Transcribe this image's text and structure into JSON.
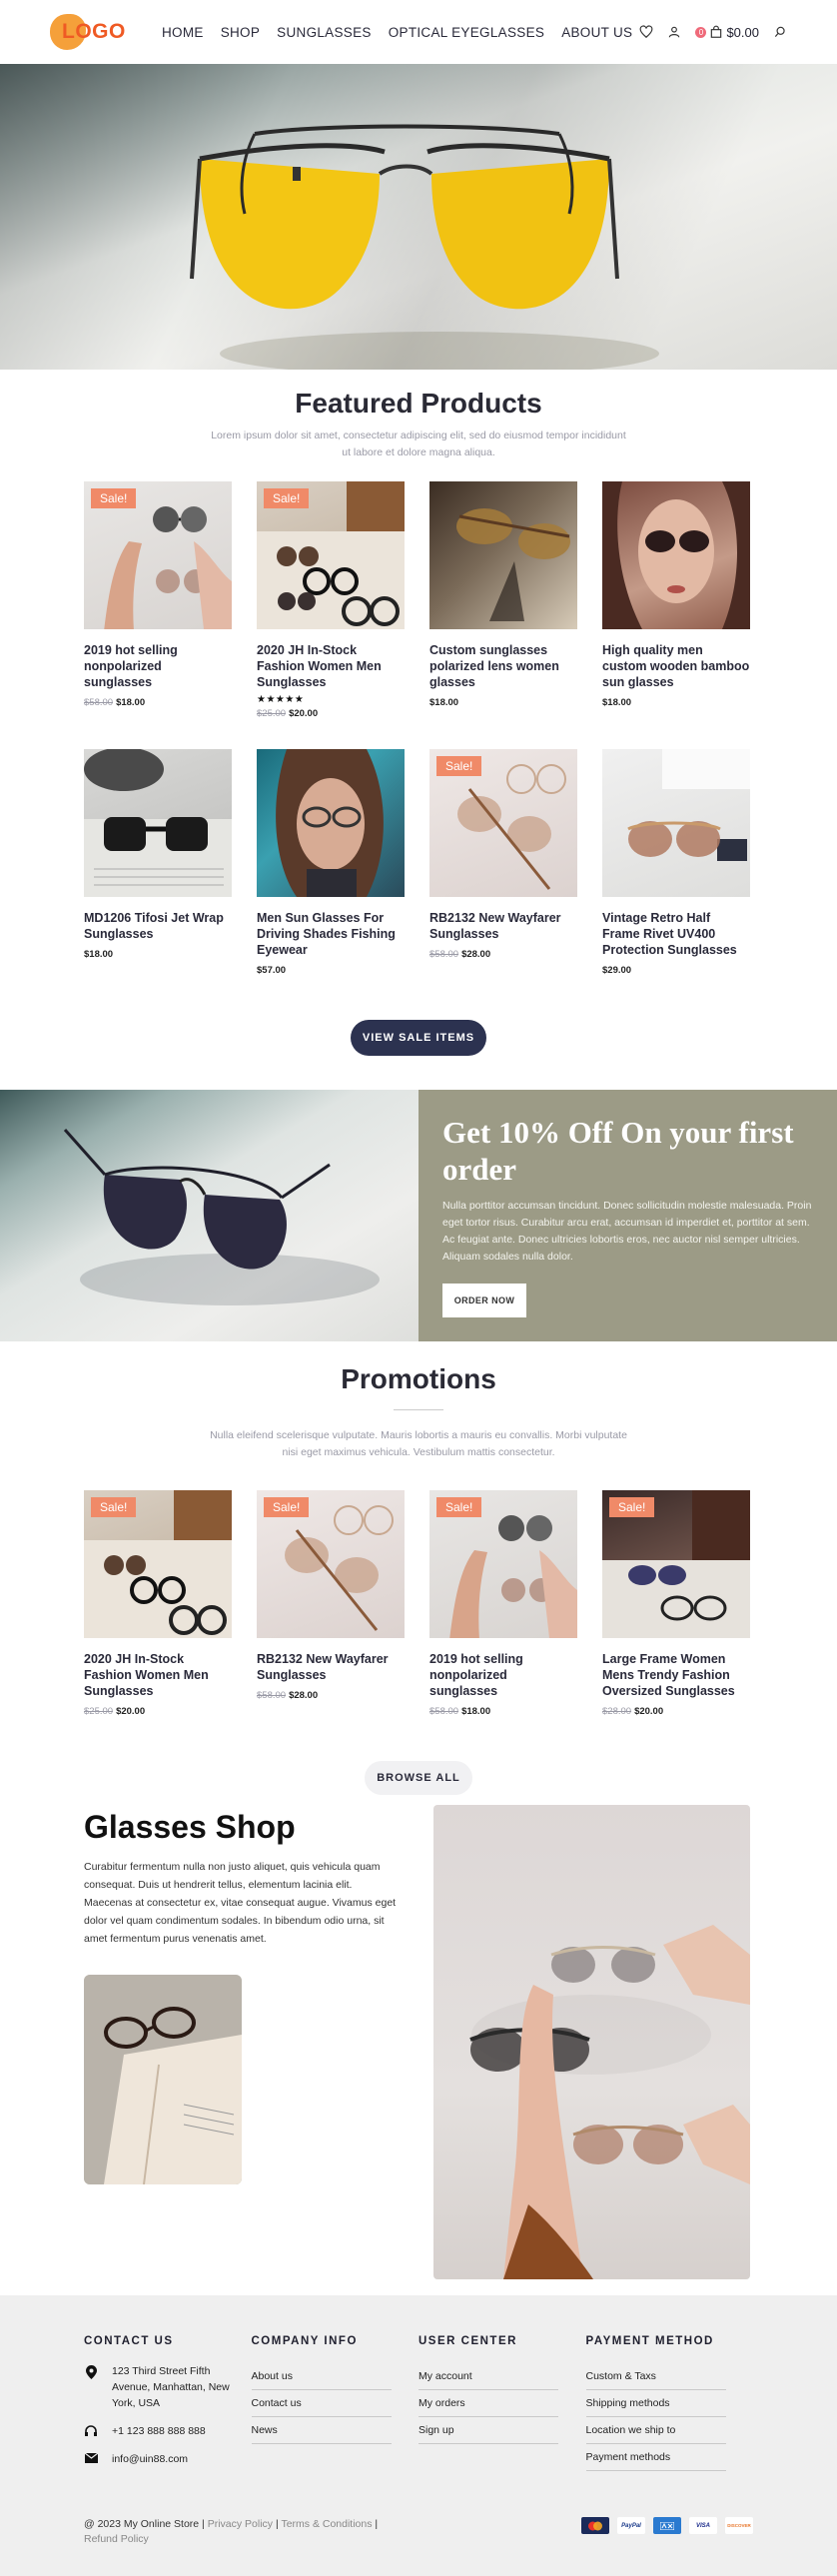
{
  "header": {
    "logo_text": "LOGO",
    "nav": [
      "HOME",
      "SHOP",
      "SUNGLASSES",
      "OPTICAL EYEGLASSES",
      "ABOUT US"
    ],
    "cart_count": "0",
    "cart_total": "$0.00"
  },
  "featured": {
    "title": "Featured Products",
    "subtitle": "Lorem ipsum dolor sit amet, consectetur adipiscing elit, sed do eiusmod tempor incididunt ut labore et dolore magna aliqua.",
    "products": [
      {
        "sale": "Sale!",
        "title": "2019 hot selling nonpolarized sunglasses",
        "old_price": "$58.00",
        "price": "$18.00"
      },
      {
        "sale": "Sale!",
        "title": "2020 JH In-Stock Fashion Women Men Sunglasses",
        "rating": 5,
        "old_price": "$25.00",
        "price": "$20.00"
      },
      {
        "sale": "",
        "title": "Custom sunglasses polarized lens women glasses",
        "old_price": "",
        "price": "$18.00"
      },
      {
        "sale": "",
        "title": "High quality men custom wooden bamboo sun glasses",
        "old_price": "",
        "price": "$18.00"
      },
      {
        "sale": "",
        "title": "MD1206 Tifosi Jet Wrap Sunglasses",
        "old_price": "",
        "price": "$18.00"
      },
      {
        "sale": "",
        "title": "Men Sun Glasses For Driving Shades Fishing Eyewear",
        "old_price": "",
        "price": "$57.00"
      },
      {
        "sale": "Sale!",
        "title": "RB2132 New Wayfarer Sunglasses",
        "old_price": "$58.00",
        "price": "$28.00"
      },
      {
        "sale": "",
        "title": "Vintage Retro Half Frame Rivet UV400 Protection Sunglasses",
        "old_price": "",
        "price": "$29.00"
      }
    ],
    "button": "VIEW SALE ITEMS"
  },
  "banner": {
    "title": "Get 10% Off On your first order",
    "body": "Nulla porttitor accumsan tincidunt. Donec sollicitudin molestie malesuada. Proin eget tortor risus. Curabitur arcu erat, accumsan id imperdiet et, porttitor at sem. Ac feugiat ante. Donec ultricies lobortis eros, nec auctor nisl semper ultricies. Aliquam sodales nulla dolor.",
    "button": "ORDER NOW"
  },
  "promotions": {
    "title": "Promotions",
    "subtitle": "Nulla eleifend scelerisque vulputate. Mauris lobortis a mauris eu convallis. Morbi vulputate nisi eget maximus vehicula. Vestibulum mattis consectetur.",
    "products": [
      {
        "sale": "Sale!",
        "title": "2020 JH In-Stock Fashion Women Men Sunglasses",
        "old_price": "$25.00",
        "price": "$20.00"
      },
      {
        "sale": "Sale!",
        "title": "RB2132 New Wayfarer Sunglasses",
        "old_price": "$58.00",
        "price": "$28.00"
      },
      {
        "sale": "Sale!",
        "title": "2019 hot selling nonpolarized sunglasses",
        "old_price": "$58.00",
        "price": "$18.00"
      },
      {
        "sale": "Sale!",
        "title": "Large Frame Women Mens Trendy Fashion Oversized Sunglasses",
        "old_price": "$28.00",
        "price": "$20.00"
      }
    ],
    "button": "BROWSE ALL"
  },
  "shop": {
    "title": "Glasses Shop",
    "body": "Curabitur fermentum nulla non justo aliquet, quis vehicula quam consequat. Duis ut hendrerit tellus, elementum lacinia elit. Maecenas at consectetur ex, vitae consequat augue. Vivamus eget dolor vel quam condimentum sodales. In bibendum odio urna, sit amet fermentum purus venenatis amet."
  },
  "footer": {
    "contact": {
      "heading": "CONTACT US",
      "address": "123 Third Street Fifth Avenue, Manhattan, New York, USA",
      "phone": "+1 123 888 888 888",
      "email": "info@uin88.com"
    },
    "company": {
      "heading": "COMPANY INFO",
      "links": [
        "About us",
        "Contact us",
        "News"
      ]
    },
    "user": {
      "heading": "USER CENTER",
      "links": [
        "My account",
        "My orders",
        "Sign up"
      ]
    },
    "payment": {
      "heading": "PAYMENT METHOD",
      "links": [
        "Custom & Taxs",
        "Shipping methods",
        "Location we ship to",
        "Payment methods"
      ]
    },
    "copyright": "@ 2023 My Online Store |",
    "legal": [
      "Privacy Policy",
      "Terms & Conditions",
      "Refund Policy"
    ],
    "payment_icons": [
      "mastercard-icon",
      "paypal-icon",
      "amex-icon",
      "visa-icon",
      "discover-icon"
    ],
    "payment_labels": [
      "",
      "PayPal",
      "",
      "VISA",
      "DISCOVER"
    ]
  },
  "colors": {
    "accent": "#ef5a24",
    "sale_badge": "#f08a68",
    "dark_button": "#2c3250",
    "banner_bg": "#9c9b86",
    "footer_bg": "#efefef"
  }
}
